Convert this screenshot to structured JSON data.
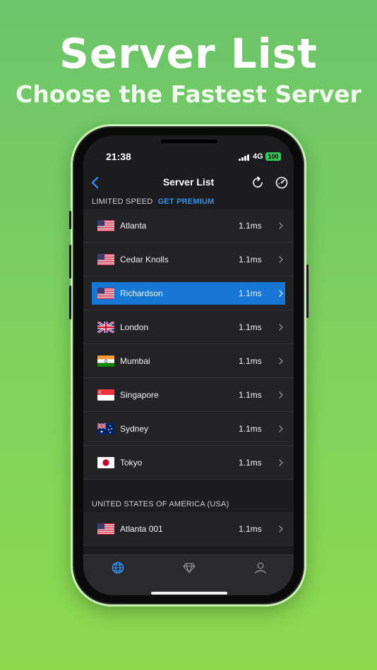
{
  "promo": {
    "title": "Server List",
    "subtitle": "Choose the Fastest Server"
  },
  "status_bar": {
    "time": "21:38",
    "network": "4G",
    "battery": "100"
  },
  "nav": {
    "title": "Server List",
    "back_icon": "chevron-left-icon",
    "refresh_icon": "refresh-icon",
    "speedtest_icon": "speedometer-icon"
  },
  "sections": {
    "limited": {
      "label": "LIMITED SPEED",
      "premium_link": "GET PREMIUM"
    },
    "usa": {
      "label": "UNITED STATES OF AMERICA (USA)"
    }
  },
  "servers": [
    {
      "name": "Atlanta",
      "ping": "1.1ms",
      "flag": "us",
      "selected": false
    },
    {
      "name": "Cedar Knolls",
      "ping": "1.1ms",
      "flag": "us",
      "selected": false
    },
    {
      "name": "Richardson",
      "ping": "1.1ms",
      "flag": "us",
      "selected": true
    },
    {
      "name": "London",
      "ping": "1.1ms",
      "flag": "uk",
      "selected": false
    },
    {
      "name": "Mumbai",
      "ping": "1.1ms",
      "flag": "in",
      "selected": false
    },
    {
      "name": "Singapore",
      "ping": "1.1ms",
      "flag": "sg",
      "selected": false
    },
    {
      "name": "Sydney",
      "ping": "1.1ms",
      "flag": "au",
      "selected": false
    },
    {
      "name": "Tokyo",
      "ping": "1.1ms",
      "flag": "jp",
      "selected": false
    }
  ],
  "usa_servers": [
    {
      "name": "Atlanta 001",
      "ping": "1.1ms",
      "flag": "us",
      "selected": false
    }
  ],
  "tabs": [
    {
      "icon": "globe-icon",
      "active": true
    },
    {
      "icon": "diamond-icon",
      "active": false
    },
    {
      "icon": "user-icon",
      "active": false
    }
  ],
  "colors": {
    "accent": "#1877d2",
    "link": "#2f8ff0",
    "battery": "#34c759",
    "background": "#1c1c1e"
  }
}
